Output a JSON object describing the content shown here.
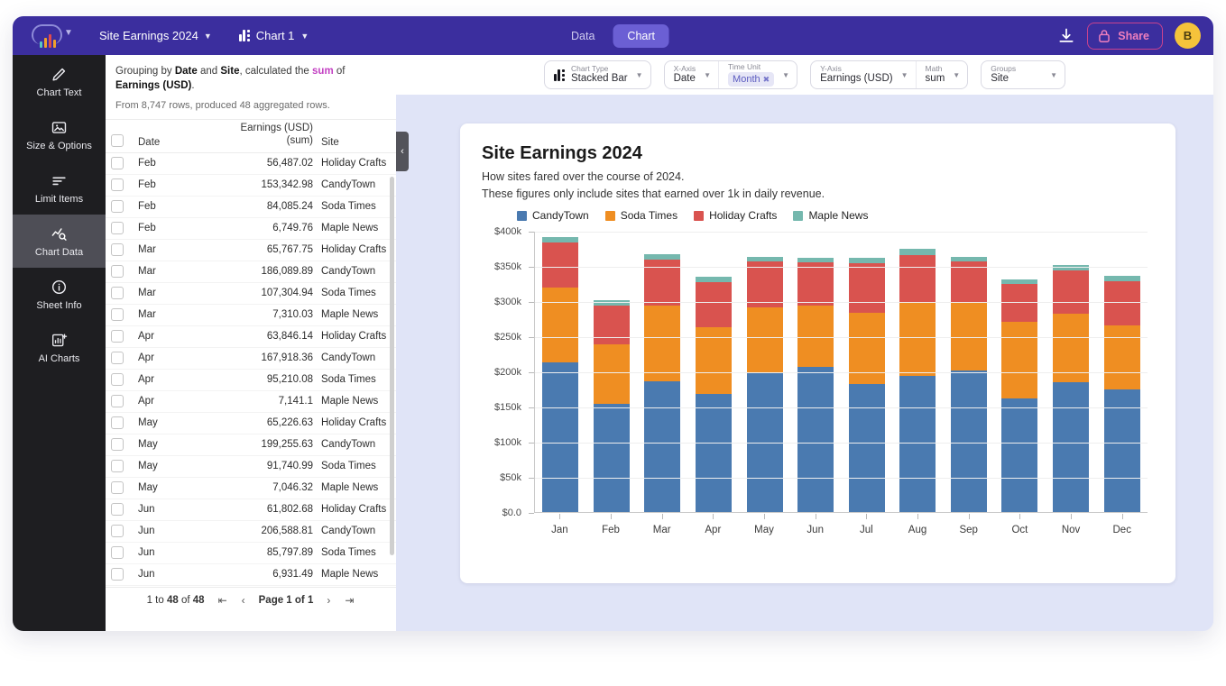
{
  "topbar": {
    "doc_title": "Site Earnings 2024",
    "chart_tab": "Chart 1",
    "tabs": [
      {
        "label": "Data",
        "active": false
      },
      {
        "label": "Chart",
        "active": true
      }
    ],
    "download_icon": "download-icon",
    "share_label": "Share",
    "lock_icon": "lock-icon",
    "avatar_initial": "B",
    "accent_purple": "#3b2e9e",
    "accent_pink": "#ef7fbd",
    "avatar_color": "#f5c33b"
  },
  "rail": {
    "items": [
      {
        "label": "Chart Text",
        "icon": "pencil-icon",
        "active": false
      },
      {
        "label": "Size & Options",
        "icon": "image-size-icon",
        "active": false
      },
      {
        "label": "Limit Items",
        "icon": "filter-lines-icon",
        "active": false
      },
      {
        "label": "Chart Data",
        "icon": "chart-search-icon",
        "active": true
      },
      {
        "label": "Sheet Info",
        "icon": "info-icon",
        "active": false
      },
      {
        "label": "AI Charts",
        "icon": "chart-plus-icon",
        "active": false
      }
    ]
  },
  "panel": {
    "summary_prefix": "Grouping by ",
    "summary_group1": "Date",
    "summary_and": " and ",
    "summary_group2": "Site",
    "summary_mid": ", calculated the ",
    "summary_math": "sum",
    "summary_of": " of ",
    "summary_measure": "Earnings (USD)",
    "summary_end": ".",
    "rows_note": "From 8,747 rows, produced 48 aggregated rows.",
    "columns": [
      "Date",
      "Earnings (USD) (sum)",
      "Site"
    ],
    "col_date": "Date",
    "col_earnings_l1": "Earnings (USD)",
    "col_earnings_l2": "(sum)",
    "col_site": "Site",
    "rows": [
      {
        "date": "Feb",
        "earnings": "56,487.02",
        "site": "Holiday Crafts"
      },
      {
        "date": "Feb",
        "earnings": "153,342.98",
        "site": "CandyTown"
      },
      {
        "date": "Feb",
        "earnings": "84,085.24",
        "site": "Soda Times"
      },
      {
        "date": "Feb",
        "earnings": "6,749.76",
        "site": "Maple News"
      },
      {
        "date": "Mar",
        "earnings": "65,767.75",
        "site": "Holiday Crafts"
      },
      {
        "date": "Mar",
        "earnings": "186,089.89",
        "site": "CandyTown"
      },
      {
        "date": "Mar",
        "earnings": "107,304.94",
        "site": "Soda Times"
      },
      {
        "date": "Mar",
        "earnings": "7,310.03",
        "site": "Maple News"
      },
      {
        "date": "Apr",
        "earnings": "63,846.14",
        "site": "Holiday Crafts"
      },
      {
        "date": "Apr",
        "earnings": "167,918.36",
        "site": "CandyTown"
      },
      {
        "date": "Apr",
        "earnings": "95,210.08",
        "site": "Soda Times"
      },
      {
        "date": "Apr",
        "earnings": "7,141.1",
        "site": "Maple News"
      },
      {
        "date": "May",
        "earnings": "65,226.63",
        "site": "Holiday Crafts"
      },
      {
        "date": "May",
        "earnings": "199,255.63",
        "site": "CandyTown"
      },
      {
        "date": "May",
        "earnings": "91,740.99",
        "site": "Soda Times"
      },
      {
        "date": "May",
        "earnings": "7,046.32",
        "site": "Maple News"
      },
      {
        "date": "Jun",
        "earnings": "61,802.68",
        "site": "Holiday Crafts"
      },
      {
        "date": "Jun",
        "earnings": "206,588.81",
        "site": "CandyTown"
      },
      {
        "date": "Jun",
        "earnings": "85,797.89",
        "site": "Soda Times"
      },
      {
        "date": "Jun",
        "earnings": "6,931.49",
        "site": "Maple News"
      }
    ],
    "pager": {
      "range": "1 to 48 of 48",
      "range_from": "1",
      "range_bold_1": "48",
      "range_bold_2": "48",
      "page_text": "Page 1 of 1",
      "first_icon": "first-page-icon",
      "prev_icon": "prev-page-icon",
      "next_icon": "next-page-icon",
      "last_icon": "last-page-icon"
    },
    "collapse_icon": "chevron-left-icon"
  },
  "toolbar": {
    "chart_type": {
      "key": "Chart Type",
      "value": "Stacked Bar",
      "icon": "bar-chart-icon"
    },
    "x_axis": {
      "key": "X-Axis",
      "value": "Date"
    },
    "time_unit": {
      "key": "Time Unit",
      "value": "Month",
      "removable": true
    },
    "y_axis": {
      "key": "Y-Axis",
      "value": "Earnings (USD)"
    },
    "math": {
      "key": "Math",
      "value": "sum"
    },
    "groups": {
      "key": "Groups",
      "value": "Site"
    }
  },
  "chart_data": {
    "type": "bar",
    "title": "Site Earnings 2024",
    "subtitle_line1": "How sites fared over the course of 2024.",
    "subtitle_line2": "These figures only include sites that earned over 1k in daily revenue.",
    "xlabel": "",
    "ylabel": "",
    "stacked": true,
    "grid": true,
    "legend_position": "top",
    "ylim": [
      0,
      400000
    ],
    "yticks": [
      0,
      50000,
      100000,
      150000,
      200000,
      250000,
      300000,
      350000,
      400000
    ],
    "ytick_labels": [
      "$0.0",
      "$50k",
      "$100k",
      "$150k",
      "$200k",
      "$250k",
      "$300k",
      "$350k",
      "$400k"
    ],
    "categories": [
      "Jan",
      "Feb",
      "Mar",
      "Apr",
      "May",
      "Jun",
      "Jul",
      "Aug",
      "Sep",
      "Oct",
      "Nov",
      "Dec"
    ],
    "series": [
      {
        "name": "CandyTown",
        "color": "#4a7ab0",
        "values": [
          213000,
          154000,
          186000,
          168000,
          199000,
          207000,
          182000,
          194000,
          201000,
          161000,
          185000,
          175000
        ]
      },
      {
        "name": "Soda Times",
        "color": "#ef8e22",
        "values": [
          106000,
          84000,
          107000,
          95000,
          92000,
          86000,
          102000,
          103000,
          97000,
          110000,
          97000,
          91000
        ]
      },
      {
        "name": "Holiday Crafts",
        "color": "#d9534f",
        "values": [
          65000,
          56000,
          66000,
          64000,
          65000,
          62000,
          70000,
          69000,
          58000,
          53000,
          61000,
          62000
        ]
      },
      {
        "name": "Maple News",
        "color": "#75b8ae",
        "values": [
          7300,
          6750,
          7310,
          7140,
          7050,
          6930,
          7200,
          8400,
          7300,
          7400,
          8200,
          7600
        ]
      }
    ]
  }
}
